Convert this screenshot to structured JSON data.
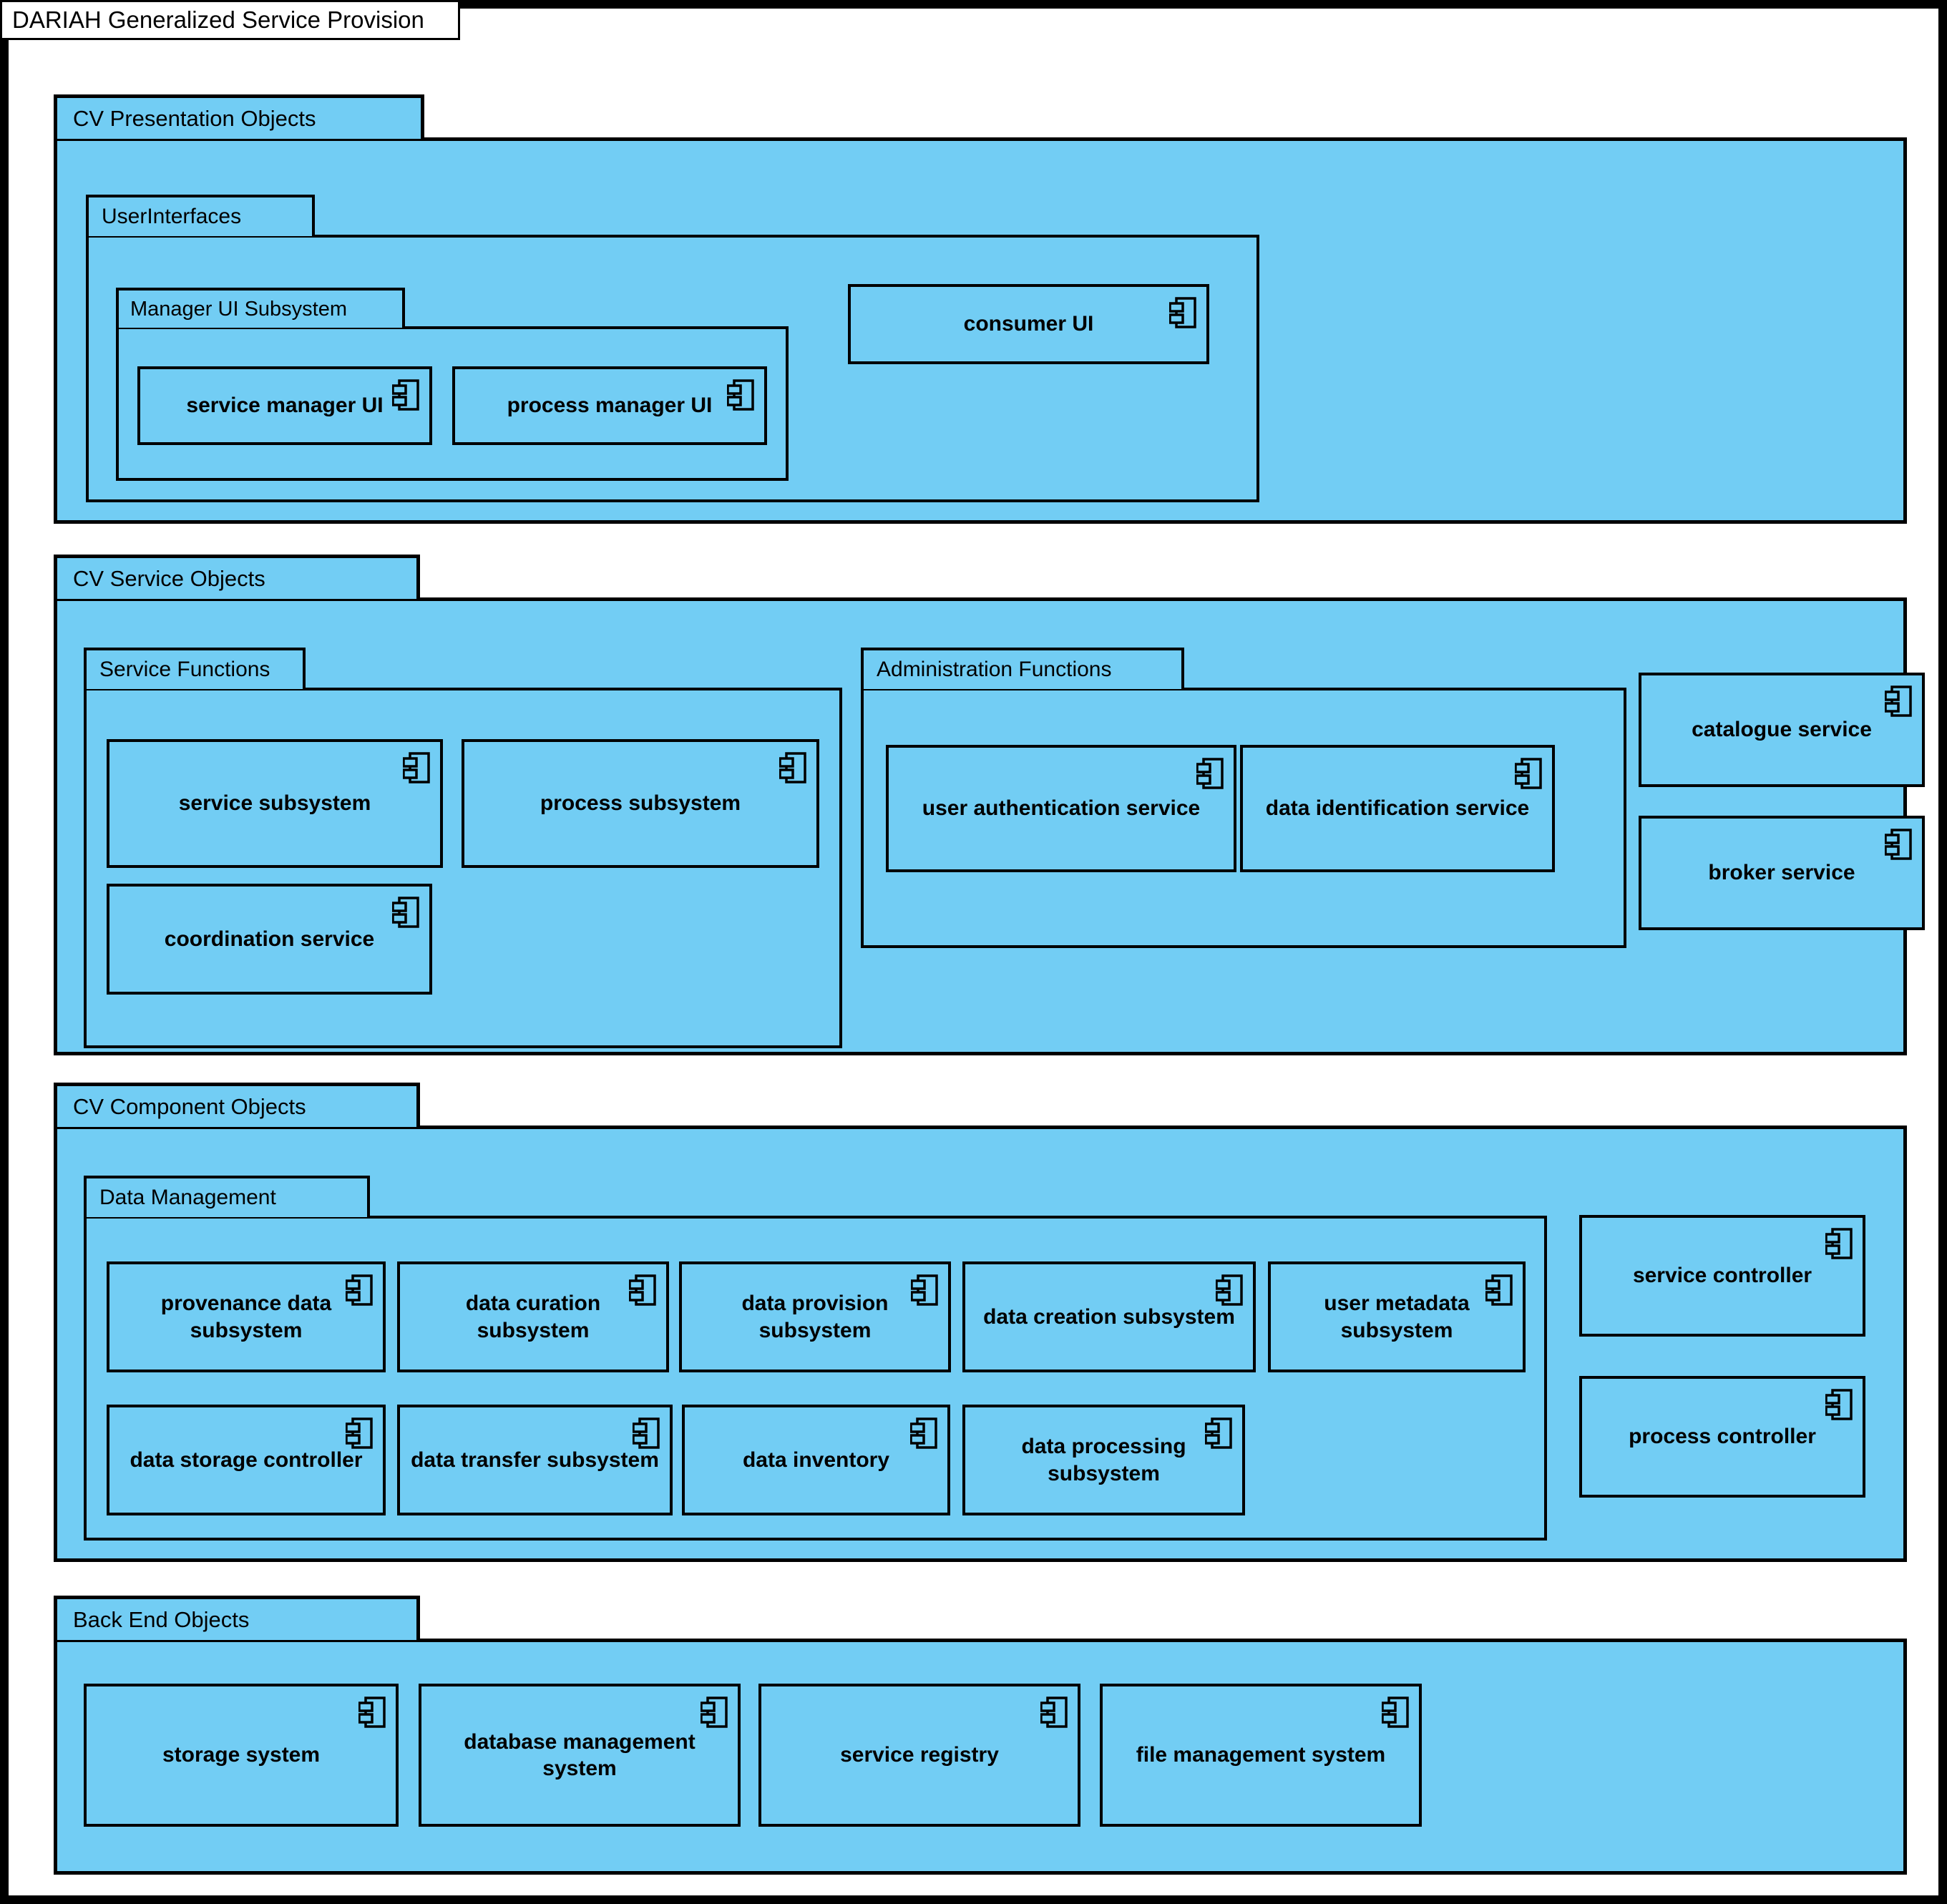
{
  "diagram": {
    "title": "DARIAH Generalized Service Provision",
    "accent_fill": "#72cdf4",
    "stroke": "#000000",
    "background": "#ffffff",
    "frame": "#000000",
    "component_icon": "uml-component-icon"
  },
  "packages": {
    "presentation": {
      "label": "CV Presentation Objects",
      "user_interfaces": {
        "label": "UserInterfaces",
        "manager_ui_subsystem": {
          "label": "Manager UI Subsystem",
          "components": [
            {
              "label": "service manager UI"
            },
            {
              "label": "process manager UI"
            }
          ]
        },
        "components": [
          {
            "label": "consumer UI"
          }
        ]
      }
    },
    "service": {
      "label": "CV Service Objects",
      "service_functions": {
        "label": "Service Functions",
        "components": [
          {
            "label": "service subsystem"
          },
          {
            "label": "process subsystem"
          },
          {
            "label": "coordination service"
          }
        ]
      },
      "administration_functions": {
        "label": "Administration Functions",
        "components": [
          {
            "label": "user authentication service"
          },
          {
            "label": "data identification service"
          }
        ]
      },
      "components": [
        {
          "label": "catalogue service"
        },
        {
          "label": "broker service"
        }
      ]
    },
    "component_objects": {
      "label": "CV Component Objects",
      "data_management": {
        "label": "Data Management",
        "row1": [
          {
            "label": "provenance data subsystem"
          },
          {
            "label": "data curation subsystem"
          },
          {
            "label": "data provision subsystem"
          },
          {
            "label": "data creation subsystem"
          },
          {
            "label": "user metadata subsystem"
          }
        ],
        "row2": [
          {
            "label": "data storage controller"
          },
          {
            "label": "data transfer subsystem"
          },
          {
            "label": "data inventory"
          },
          {
            "label": "data processing subsystem"
          }
        ]
      },
      "components": [
        {
          "label": "service controller"
        },
        {
          "label": "process controller"
        }
      ]
    },
    "back_end": {
      "label": "Back End Objects",
      "components": [
        {
          "label": "storage system"
        },
        {
          "label": "database management system"
        },
        {
          "label": "service registry"
        },
        {
          "label": "file management system"
        }
      ]
    }
  }
}
